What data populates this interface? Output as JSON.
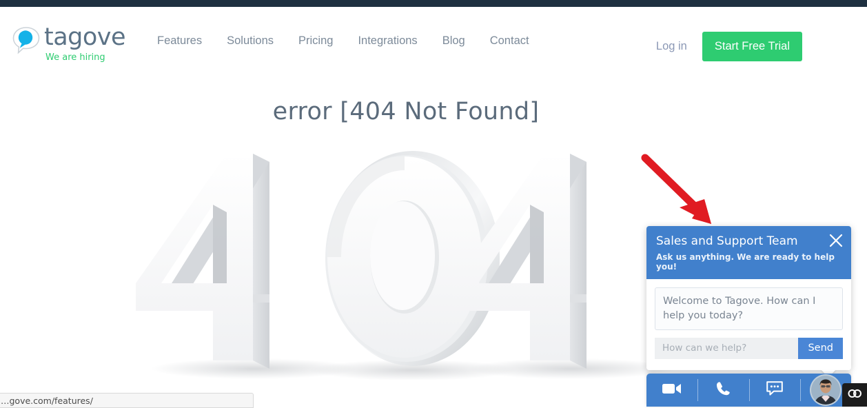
{
  "page": {
    "error_title": "error [404 Not Found]",
    "graphic_label": "404",
    "top_strip_color": "#1e3040"
  },
  "header": {
    "logo": {
      "wordmark": "tagove",
      "tagline": "We are hiring",
      "mark_icon": "speech-bubble-icon",
      "wordmark_color": "#5b7286",
      "tagline_color": "#2ecc71"
    },
    "nav": [
      {
        "label": "Features"
      },
      {
        "label": "Solutions"
      },
      {
        "label": "Pricing"
      },
      {
        "label": "Integrations"
      },
      {
        "label": "Blog"
      },
      {
        "label": "Contact"
      }
    ],
    "actions": {
      "login_label": "Log in",
      "trial_label": "Start Free Trial",
      "trial_color": "#2ecc71"
    }
  },
  "annotation": {
    "arrow_icon": "red-arrow-icon",
    "arrow_color": "#e01b22"
  },
  "chat_widget": {
    "title": "Sales and Support Team",
    "subtitle": "Ask us anything. We are ready to help you!",
    "close_icon": "close-icon",
    "header_color": "#4180cc",
    "message": "Welcome to Tagove. How can I help you today?",
    "input_placeholder": "How can we help?",
    "input_value": "",
    "send_label": "Send",
    "send_color": "#4a86d6"
  },
  "action_bar": {
    "items": [
      {
        "icon": "video-camera-icon"
      },
      {
        "icon": "phone-icon"
      },
      {
        "icon": "chat-bubble-icon"
      },
      {
        "icon": "agent-avatar"
      }
    ],
    "bar_color": "#4180cc"
  },
  "corner_badge": {
    "icon": "chain-link-icon",
    "background": "#1c1c1c"
  },
  "status_bar": {
    "url_text": "…gove.com/features/"
  }
}
